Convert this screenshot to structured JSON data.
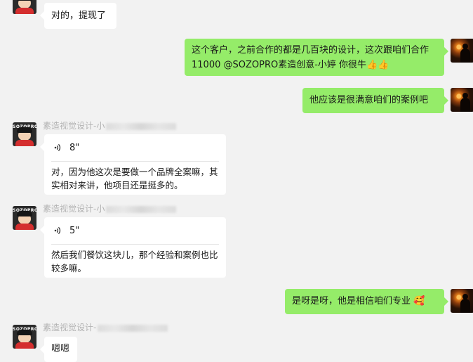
{
  "messages": {
    "m1": {
      "text": "对的，提现了"
    },
    "m2": {
      "text": "这个客户，之前合作的都是几百块的设计，这次跟咱们合作11000 @SOZOPRO素造创意-小婷 你很牛",
      "emoji": "👍👍"
    },
    "m3": {
      "text": "他应该是很满意咱们的案例吧"
    },
    "m4": {
      "sender": "素造视觉设计-小",
      "voice_duration": "8\"",
      "transcript": "对，因为他这次是要做一个品牌全案嘛，其实相对来讲，他项目还是挺多的。"
    },
    "m5": {
      "sender": "素造视觉设计-小",
      "voice_duration": "5\"",
      "transcript": "然后我们餐饮这块儿，那个经验和案例也比较多嘛。"
    },
    "m6": {
      "text": "是呀是呀，他是相信咱们专业",
      "emoji": "🥰"
    },
    "m7": {
      "sender": "素造视觉设计-",
      "text": "嗯嗯"
    }
  },
  "avatar_logo_text": "SOZOPRO",
  "colors": {
    "background": "#f2f2f2",
    "self_bubble": "#95ec69",
    "other_bubble": "#ffffff",
    "sender_name": "#b2b2b2"
  },
  "icons": {
    "voice": "voice-wave-icon"
  }
}
